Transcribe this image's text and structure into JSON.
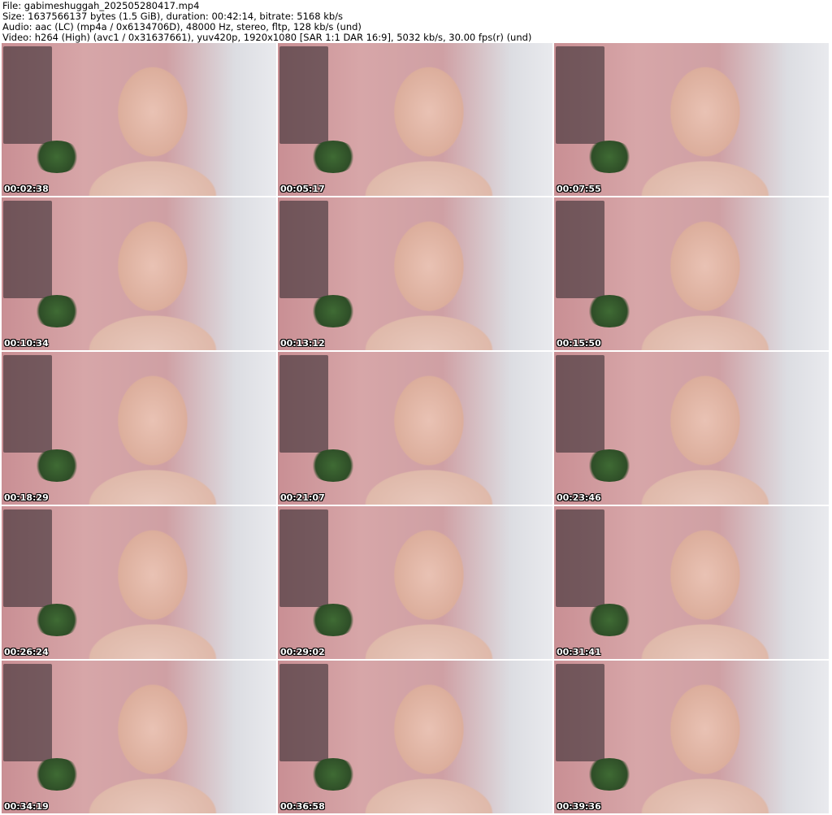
{
  "header": {
    "file": "File: gabimeshuggah_202505280417.mp4",
    "size": "Size: 1637566137 bytes (1.5 GiB), duration: 00:42:14, bitrate: 5168 kb/s",
    "audio": "Audio: aac (LC) (mp4a / 0x6134706D), 48000 Hz, stereo, fltp, 128 kb/s (und)",
    "video": "Video: h264 (High) (avc1 / 0x31637661), yuv420p, 1920x1080 [SAR 1:1 DAR 16:9], 5032 kb/s, 30.00 fps(r) (und)"
  },
  "thumbnails": [
    {
      "timestamp": "00:02:38"
    },
    {
      "timestamp": "00:05:17"
    },
    {
      "timestamp": "00:07:55"
    },
    {
      "timestamp": "00:10:34"
    },
    {
      "timestamp": "00:13:12"
    },
    {
      "timestamp": "00:15:50"
    },
    {
      "timestamp": "00:18:29"
    },
    {
      "timestamp": "00:21:07"
    },
    {
      "timestamp": "00:23:46"
    },
    {
      "timestamp": "00:26:24"
    },
    {
      "timestamp": "00:29:02"
    },
    {
      "timestamp": "00:31:41"
    },
    {
      "timestamp": "00:34:19"
    },
    {
      "timestamp": "00:36:58"
    },
    {
      "timestamp": "00:39:36"
    }
  ]
}
